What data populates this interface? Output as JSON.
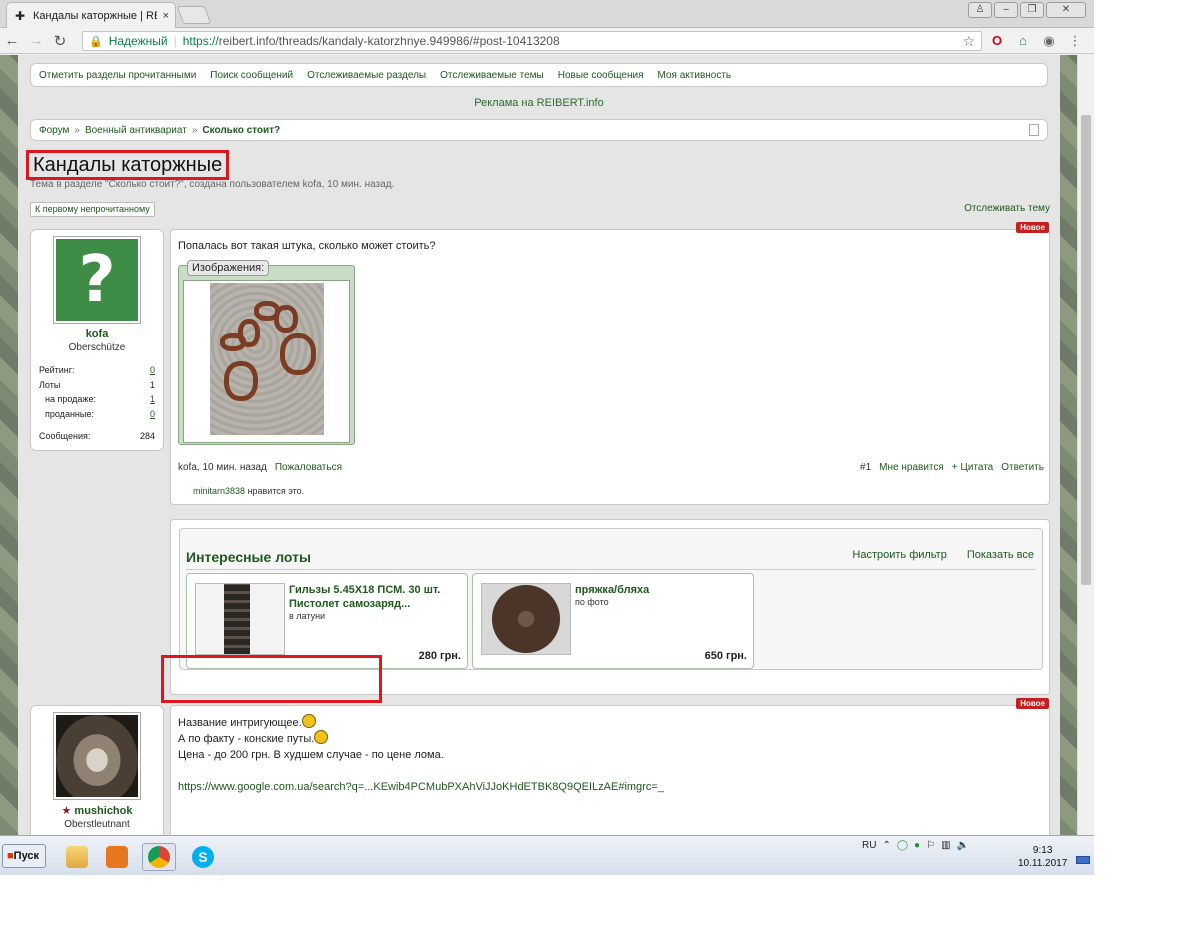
{
  "browser": {
    "tab_title": "Кандалы каторжные | REI",
    "tab_close": "×",
    "secure_label": "Надежный",
    "url_proto": "https://",
    "url_rest": "reibert.info/threads/kandaly-katorzhnye.949986/#post-10413208"
  },
  "forum_nav": {
    "items": [
      "Отметить разделы прочитанными",
      "Поиск сообщений",
      "Отслеживаемые разделы",
      "Отслеживаемые темы",
      "Новые сообщения",
      "Моя активность"
    ]
  },
  "ad_text": "Реклама на REIBERT.info",
  "breadcrumb": {
    "items": [
      "Форум",
      "Военный антиквариат"
    ],
    "separator": "»",
    "current": "Сколько стоит?"
  },
  "thread": {
    "title": "Кандалы каторжные",
    "meta": "Тема в разделе \"Сколько стоит?\", создана пользователем kofa, 10 мин. назад.",
    "unread_button": "К первому непрочитанному",
    "watch_link": "Отслеживать тему"
  },
  "post1": {
    "badge": "Новое",
    "user": {
      "name": "kofa",
      "title": "Oberschütze",
      "stats": {
        "rating_label": "Рейтинг:",
        "rating": "0",
        "lots_label": "Лоты",
        "lots": "1",
        "on_sale_label": "на продаже:",
        "on_sale": "1",
        "sold_label": "проданные:",
        "sold": "0",
        "messages_label": "Сообщения:",
        "messages": "284"
      }
    },
    "text": "Попалась вот такая штука, сколько может стоить?",
    "attach_label": "Изображения:",
    "footer": {
      "author_time": "kofa, 10 мин. назад",
      "report": "Пожаловаться",
      "number": "#1",
      "like": "Мне нравится",
      "quote": "+ Цитата",
      "reply": "Ответить"
    },
    "likes": {
      "user": "minitarn3838",
      "text": " нравится это."
    }
  },
  "lots": {
    "title": "Интересные лоты",
    "filter": "Настроить фильтр",
    "show_all": "Показать все",
    "items": [
      {
        "title": "Гильзы 5.45Х18 ПСМ. 30 шт. Пистолет самозаряд...",
        "subtitle": "в латуни",
        "price": "280 грн."
      },
      {
        "title": "пряжка/бляха",
        "subtitle": "по фото",
        "price": "650 грн."
      }
    ]
  },
  "post2": {
    "badge": "Новое",
    "user": {
      "name": "mushichok",
      "title": "Oberstleutnant"
    },
    "line1": "Название интригующее.",
    "line2": "А по факту - конские путы.",
    "line3": "Цена - до 200 грн. В худшем случае - по цене лома.",
    "link": "https://www.google.com.ua/search?q=...KEwib4PCMubPXAhViJJoKHdETBK8Q9QEILzAE#imgrc=_"
  },
  "taskbar": {
    "start": "Пуск",
    "lang": "RU",
    "time": "9:13",
    "date": "10.11.2017"
  }
}
